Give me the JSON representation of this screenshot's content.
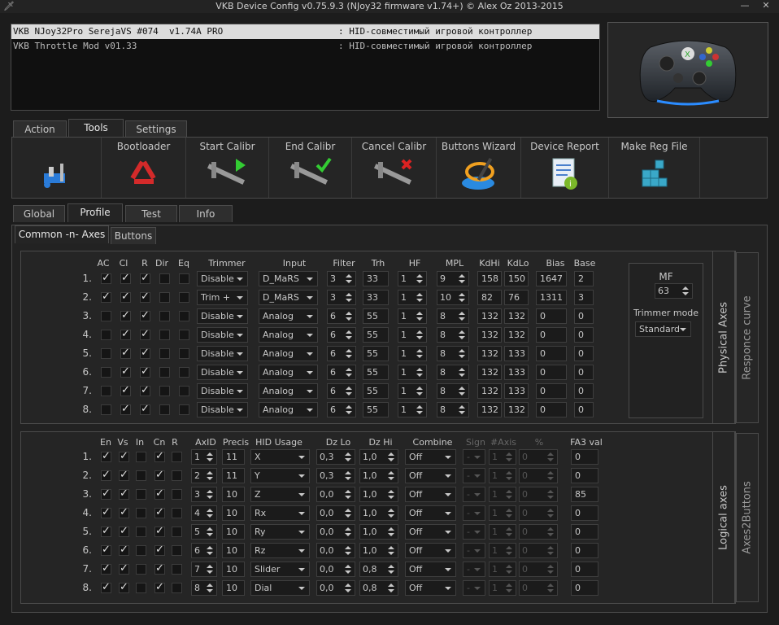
{
  "window": {
    "title": "VKB Device Config v0.75.9.3 (NJoy32 firmware v1.74+) © Alex Oz 2013-2015"
  },
  "devices": [
    {
      "name": "VKB NJoy32Pro SerejaVS #074  v1.74A PRO",
      "type": ": HID-совместимый игровой контроллер"
    },
    {
      "name": "VKB Throttle Mod v01.33",
      "type": ": HID-совместимый игровой контроллер"
    }
  ],
  "main_tabs": [
    "Action",
    "Tools",
    "Settings"
  ],
  "tools": [
    "",
    "Bootloader",
    "Start Calibr",
    "End Calibr",
    "Cancel Calibr",
    "Buttons Wizard",
    "Device Report",
    "Make Reg File"
  ],
  "sub_tabs": [
    "Global",
    "Profile",
    "Test",
    "Info"
  ],
  "inner_tabs": [
    "Common -n- Axes",
    "Buttons"
  ],
  "physical": {
    "headers": [
      "AC",
      "Cl",
      "R",
      "Dir",
      "Eq",
      "Trimmer",
      "Input",
      "Filter",
      "Trh",
      "HF",
      "MPL",
      "KdHi",
      "KdLo",
      "Bias",
      "Base"
    ],
    "rows": [
      {
        "n": "1.",
        "ac": true,
        "cl": true,
        "r": true,
        "dir": false,
        "eq": false,
        "trimmer": "Disable",
        "input": "D_MaRS",
        "filter": "3",
        "trh": "33",
        "hf": "1",
        "mpl": "9",
        "kdhi": "158",
        "kdlo": "150",
        "bias": "1647",
        "base": "2"
      },
      {
        "n": "2.",
        "ac": true,
        "cl": true,
        "r": true,
        "dir": false,
        "eq": false,
        "trimmer": "Trim +",
        "input": "D_MaRS",
        "filter": "3",
        "trh": "33",
        "hf": "1",
        "mpl": "10",
        "kdhi": "82",
        "kdlo": "76",
        "bias": "1311",
        "base": "3"
      },
      {
        "n": "3.",
        "ac": false,
        "cl": true,
        "r": true,
        "dir": false,
        "eq": false,
        "trimmer": "Disable",
        "input": "Analog",
        "filter": "6",
        "trh": "55",
        "hf": "1",
        "mpl": "8",
        "kdhi": "132",
        "kdlo": "132",
        "bias": "0",
        "base": "0"
      },
      {
        "n": "4.",
        "ac": false,
        "cl": true,
        "r": true,
        "dir": false,
        "eq": false,
        "trimmer": "Disable",
        "input": "Analog",
        "filter": "6",
        "trh": "55",
        "hf": "1",
        "mpl": "8",
        "kdhi": "132",
        "kdlo": "132",
        "bias": "0",
        "base": "0"
      },
      {
        "n": "5.",
        "ac": false,
        "cl": true,
        "r": true,
        "dir": false,
        "eq": false,
        "trimmer": "Disable",
        "input": "Analog",
        "filter": "6",
        "trh": "55",
        "hf": "1",
        "mpl": "8",
        "kdhi": "132",
        "kdlo": "133",
        "bias": "0",
        "base": "0"
      },
      {
        "n": "6.",
        "ac": false,
        "cl": true,
        "r": true,
        "dir": false,
        "eq": false,
        "trimmer": "Disable",
        "input": "Analog",
        "filter": "6",
        "trh": "55",
        "hf": "1",
        "mpl": "8",
        "kdhi": "132",
        "kdlo": "133",
        "bias": "0",
        "base": "0"
      },
      {
        "n": "7.",
        "ac": false,
        "cl": true,
        "r": true,
        "dir": false,
        "eq": false,
        "trimmer": "Disable",
        "input": "Analog",
        "filter": "6",
        "trh": "55",
        "hf": "1",
        "mpl": "8",
        "kdhi": "132",
        "kdlo": "133",
        "bias": "0",
        "base": "0"
      },
      {
        "n": "8.",
        "ac": false,
        "cl": true,
        "r": true,
        "dir": false,
        "eq": false,
        "trimmer": "Disable",
        "input": "Analog",
        "filter": "6",
        "trh": "55",
        "hf": "1",
        "mpl": "8",
        "kdhi": "132",
        "kdlo": "132",
        "bias": "0",
        "base": "0"
      }
    ],
    "mf": {
      "label": "MF",
      "value": "63",
      "trimmer_mode_label": "Trimmer mode",
      "trimmer_mode": "Standard"
    },
    "side_tabs": [
      "Physical Axes",
      "Responce curve"
    ]
  },
  "logical": {
    "headers": [
      "En",
      "Vs",
      "In",
      "Cn",
      "R",
      "AxID",
      "Precis",
      "HID Usage",
      "Dz Lo",
      "Dz Hi",
      "Combine",
      "Sign",
      "#Axis",
      "%",
      "FA3 val"
    ],
    "rows": [
      {
        "n": "1.",
        "en": true,
        "vs": true,
        "in": false,
        "cn": true,
        "r": false,
        "axid": "1",
        "precis": "11",
        "usage": "X",
        "dzlo": "0,3",
        "dzhi": "1,0",
        "combine": "Off",
        "sign": "-",
        "axis": "1",
        "pct": "0",
        "fa3": "0"
      },
      {
        "n": "2.",
        "en": true,
        "vs": true,
        "in": false,
        "cn": true,
        "r": false,
        "axid": "2",
        "precis": "11",
        "usage": "Y",
        "dzlo": "0,3",
        "dzhi": "1,0",
        "combine": "Off",
        "sign": "-",
        "axis": "1",
        "pct": "0",
        "fa3": "0"
      },
      {
        "n": "3.",
        "en": true,
        "vs": true,
        "in": false,
        "cn": true,
        "r": false,
        "axid": "3",
        "precis": "10",
        "usage": "Z",
        "dzlo": "0,0",
        "dzhi": "1,0",
        "combine": "Off",
        "sign": "-",
        "axis": "1",
        "pct": "0",
        "fa3": "85"
      },
      {
        "n": "4.",
        "en": true,
        "vs": true,
        "in": false,
        "cn": true,
        "r": false,
        "axid": "4",
        "precis": "10",
        "usage": "Rx",
        "dzlo": "0,0",
        "dzhi": "1,0",
        "combine": "Off",
        "sign": "-",
        "axis": "1",
        "pct": "0",
        "fa3": "0"
      },
      {
        "n": "5.",
        "en": true,
        "vs": true,
        "in": false,
        "cn": true,
        "r": false,
        "axid": "5",
        "precis": "10",
        "usage": "Ry",
        "dzlo": "0,0",
        "dzhi": "1,0",
        "combine": "Off",
        "sign": "-",
        "axis": "1",
        "pct": "0",
        "fa3": "0"
      },
      {
        "n": "6.",
        "en": true,
        "vs": true,
        "in": false,
        "cn": true,
        "r": false,
        "axid": "6",
        "precis": "10",
        "usage": "Rz",
        "dzlo": "0,0",
        "dzhi": "1,0",
        "combine": "Off",
        "sign": "-",
        "axis": "1",
        "pct": "0",
        "fa3": "0"
      },
      {
        "n": "7.",
        "en": true,
        "vs": true,
        "in": false,
        "cn": true,
        "r": false,
        "axid": "7",
        "precis": "10",
        "usage": "Slider",
        "dzlo": "0,0",
        "dzhi": "0,8",
        "combine": "Off",
        "sign": "-",
        "axis": "1",
        "pct": "0",
        "fa3": "0"
      },
      {
        "n": "8.",
        "en": true,
        "vs": true,
        "in": false,
        "cn": true,
        "r": false,
        "axid": "8",
        "precis": "10",
        "usage": "Dial",
        "dzlo": "0,0",
        "dzhi": "0,8",
        "combine": "Off",
        "sign": "-",
        "axis": "1",
        "pct": "0",
        "fa3": "0"
      }
    ],
    "side_tabs": [
      "Logical axes",
      "Axes2Buttons"
    ]
  }
}
